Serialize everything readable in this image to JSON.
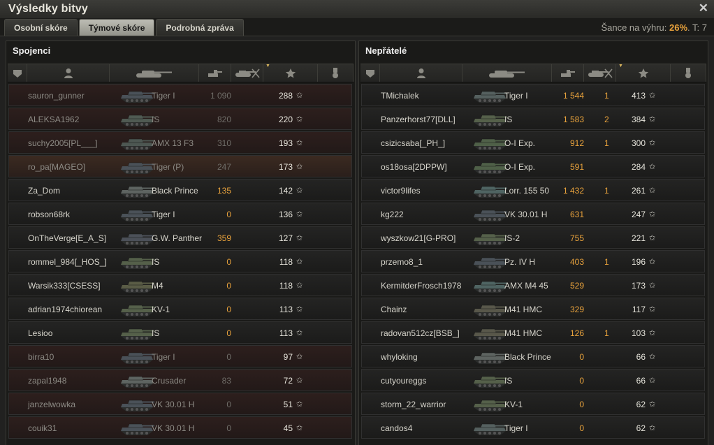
{
  "window": {
    "title": "Výsledky bitvy",
    "close_glyph": "✕"
  },
  "tabs": [
    {
      "label": "Osobní skóre",
      "active": false
    },
    {
      "label": "Týmové skóre",
      "active": true
    },
    {
      "label": "Podrobná zpráva",
      "active": false
    }
  ],
  "chance": {
    "label": "Šance na výhru:",
    "value": "26%",
    "suffix": ". T: 7"
  },
  "colors": {
    "accent": "#e8a23c",
    "dead_row": "#2d1f1d",
    "platoon_row": "#3b2a21"
  },
  "header_icons": [
    "tier-icon",
    "player-icon",
    "tank-icon",
    "damage-icon",
    "kills-icon",
    "experience-star-icon",
    "medal-icon"
  ],
  "allies": {
    "title": "Spojenci",
    "rows": [
      {
        "name": "sauron_gunner",
        "vehicle": "Tiger I",
        "damage": "1 090",
        "kills": "",
        "xp": "288",
        "state": "dead",
        "tank_color": "#4a5158"
      },
      {
        "name": "ALEKSA1962",
        "vehicle": "IS",
        "damage": "820",
        "kills": "",
        "xp": "220",
        "state": "dead",
        "tank_color": "#4f5a52"
      },
      {
        "name": "suchy2005[PL___]",
        "vehicle": "AMX 13 F3",
        "damage": "310",
        "kills": "",
        "xp": "193",
        "state": "dead",
        "tank_color": "#4d5752"
      },
      {
        "name": "ro_pa[MAGEO]",
        "vehicle": "Tiger (P)",
        "damage": "247",
        "kills": "",
        "xp": "173",
        "state": "platoon",
        "tank_color": "#4a5158"
      },
      {
        "name": "Za_Dom",
        "vehicle": "Black Prince",
        "damage": "135",
        "kills": "",
        "xp": "142",
        "state": "alive",
        "tank_color": "#5e6461"
      },
      {
        "name": "robson68rk",
        "vehicle": "Tiger I",
        "damage": "0",
        "kills": "",
        "xp": "136",
        "state": "alive",
        "tank_color": "#4a5158"
      },
      {
        "name": "OnTheVerge[E_A_S]",
        "vehicle": "G.W. Panther",
        "damage": "359",
        "kills": "",
        "xp": "127",
        "state": "alive",
        "tank_color": "#4b5058"
      },
      {
        "name": "rommel_984[_HOS_]",
        "vehicle": "IS",
        "damage": "0",
        "kills": "",
        "xp": "118",
        "state": "alive",
        "tank_color": "#55604a"
      },
      {
        "name": "Warsik333[CSESS]",
        "vehicle": "M4",
        "damage": "0",
        "kills": "",
        "xp": "118",
        "state": "alive",
        "tank_color": "#5a5c46"
      },
      {
        "name": "adrian1974chiorean",
        "vehicle": "KV-1",
        "damage": "0",
        "kills": "",
        "xp": "113",
        "state": "alive",
        "tank_color": "#55604a"
      },
      {
        "name": "Lesioo",
        "vehicle": "IS",
        "damage": "0",
        "kills": "",
        "xp": "113",
        "state": "alive",
        "tank_color": "#55604a"
      },
      {
        "name": "birra10",
        "vehicle": "Tiger I",
        "damage": "0",
        "kills": "",
        "xp": "97",
        "state": "dead",
        "tank_color": "#4a5158"
      },
      {
        "name": "zapal1948",
        "vehicle": "Crusader",
        "damage": "83",
        "kills": "",
        "xp": "72",
        "state": "dead",
        "tank_color": "#5e6461"
      },
      {
        "name": "janzelwowka",
        "vehicle": "VK 30.01 H",
        "damage": "0",
        "kills": "",
        "xp": "51",
        "state": "dead",
        "tank_color": "#4a5158"
      },
      {
        "name": "couik31",
        "vehicle": "VK 30.01 H",
        "damage": "0",
        "kills": "",
        "xp": "45",
        "state": "dead",
        "tank_color": "#4a5158"
      }
    ]
  },
  "enemies": {
    "title": "Nepřátelé",
    "rows": [
      {
        "name": "TMichalek",
        "vehicle": "Tiger I",
        "damage": "1 544",
        "kills": "1",
        "xp": "413",
        "state": "alive",
        "tank_color": "#55605f"
      },
      {
        "name": "Panzerhorst77[DLL]",
        "vehicle": "IS",
        "damage": "1 583",
        "kills": "2",
        "xp": "384",
        "state": "alive",
        "tank_color": "#55604a"
      },
      {
        "name": "csizicsaba[_PH_]",
        "vehicle": "O-I Exp.",
        "damage": "912",
        "kills": "1",
        "xp": "300",
        "state": "alive",
        "tank_color": "#4f6048"
      },
      {
        "name": "os18osa[2DPPW]",
        "vehicle": "O-I Exp.",
        "damage": "591",
        "kills": "",
        "xp": "284",
        "state": "alive",
        "tank_color": "#4f6048"
      },
      {
        "name": "victor9lifes",
        "vehicle": "Lorr. 155 50",
        "damage": "1 432",
        "kills": "1",
        "xp": "261",
        "state": "alive",
        "tank_color": "#4f6462"
      },
      {
        "name": "kg222",
        "vehicle": "VK 30.01 H",
        "damage": "631",
        "kills": "",
        "xp": "247",
        "state": "alive",
        "tank_color": "#4a5158"
      },
      {
        "name": "wyszkow21[G-PRO]",
        "vehicle": "IS-2",
        "damage": "755",
        "kills": "",
        "xp": "221",
        "state": "alive",
        "tank_color": "#55604a"
      },
      {
        "name": "przemo8_1",
        "vehicle": "Pz. IV H",
        "damage": "403",
        "kills": "1",
        "xp": "196",
        "state": "alive",
        "tank_color": "#4a5158"
      },
      {
        "name": "KermitderFrosch1978",
        "vehicle": "AMX M4 45",
        "damage": "529",
        "kills": "",
        "xp": "173",
        "state": "alive",
        "tank_color": "#4f6462"
      },
      {
        "name": "Chainz",
        "vehicle": "M41 HMC",
        "damage": "329",
        "kills": "",
        "xp": "117",
        "state": "alive",
        "tank_color": "#58574a"
      },
      {
        "name": "radovan512cz[BSB_]",
        "vehicle": "M41 HMC",
        "damage": "126",
        "kills": "1",
        "xp": "103",
        "state": "alive",
        "tank_color": "#58574a"
      },
      {
        "name": "whyloking",
        "vehicle": "Black Prince",
        "damage": "0",
        "kills": "",
        "xp": "66",
        "state": "alive",
        "tank_color": "#5e6461"
      },
      {
        "name": "cutyoureggs",
        "vehicle": "IS",
        "damage": "0",
        "kills": "",
        "xp": "66",
        "state": "alive",
        "tank_color": "#55604a"
      },
      {
        "name": "storm_22_warrior",
        "vehicle": "KV-1",
        "damage": "0",
        "kills": "",
        "xp": "62",
        "state": "alive",
        "tank_color": "#55604a"
      },
      {
        "name": "candos4",
        "vehicle": "Tiger I",
        "damage": "0",
        "kills": "",
        "xp": "62",
        "state": "alive",
        "tank_color": "#55605f"
      }
    ]
  },
  "star_glyph": "✩"
}
